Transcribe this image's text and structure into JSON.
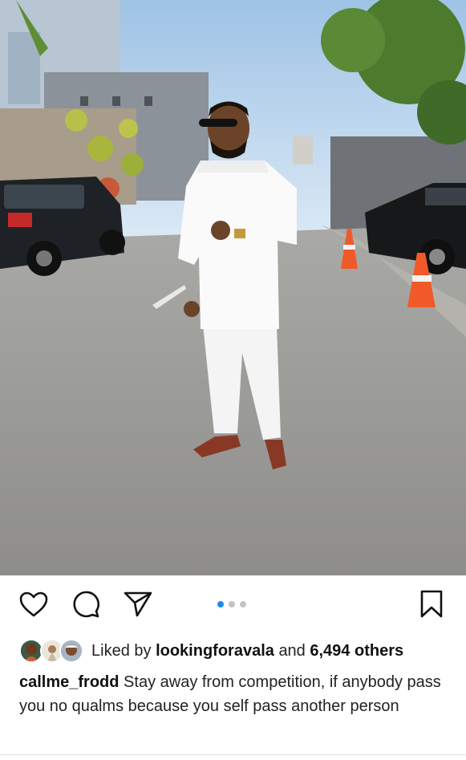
{
  "post": {
    "carousel": {
      "total": 3,
      "active_index": 0
    },
    "likes": {
      "prefix": "Liked by",
      "liker": "lookingforavala",
      "joiner": "and",
      "count_text": "6,494 others"
    },
    "caption": {
      "username": "callme_frodd",
      "text": "Stay away from competition, if anybody pass you no qualms because you self pass another person"
    }
  },
  "icons": {
    "like": "heart-icon",
    "comment": "comment-icon",
    "share": "send-icon",
    "save": "bookmark-icon"
  },
  "colors": {
    "active_dot": "#1a8cf0",
    "inactive_dot": "#c4c4c4",
    "text": "#111111"
  }
}
